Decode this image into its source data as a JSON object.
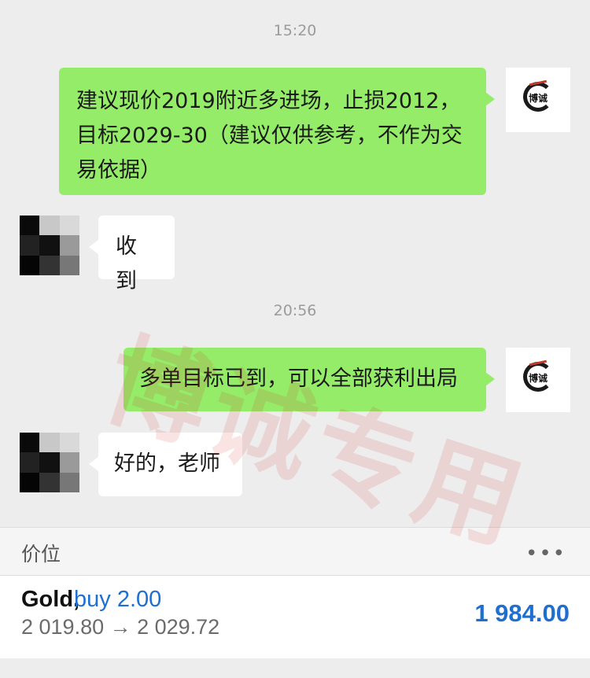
{
  "chat": {
    "timestamps": [
      "15:20",
      "20:56"
    ],
    "messages": [
      {
        "side": "right",
        "text": "建议现价2019附近多进场，止损2012，目标2029-30（建议仅供参考，不作为交易依据）"
      },
      {
        "side": "left",
        "text": "收到"
      },
      {
        "side": "right",
        "text": "多单目标已到，可以全部获利出局"
      },
      {
        "side": "left",
        "text": "好的，老师"
      }
    ],
    "brand_avatar_text": "博诚",
    "watermark": "博诚专用"
  },
  "panel": {
    "title": "价位",
    "more_icon": "•••",
    "symbol": "Gold,",
    "trade": "buy 2.00",
    "range": "2 019.80 → 2 029.72",
    "price": "1 984.00"
  },
  "colors": {
    "bubble_green": "#95ec69",
    "accent_blue": "#1f6fd1",
    "background": "#ededed"
  }
}
